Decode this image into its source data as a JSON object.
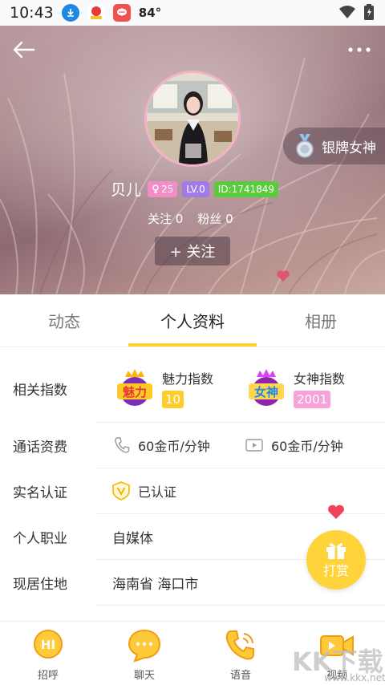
{
  "status_bar": {
    "time": "10:43",
    "temperature": "84°"
  },
  "profile": {
    "name": "贝儿",
    "age": "25",
    "level": "LV.0",
    "id": "ID:1741849",
    "follow_label": "关注",
    "follow_count": "0",
    "fans_label": "粉丝",
    "fans_count": "0",
    "follow_button": "+ 关注",
    "badge_text": "银牌女神"
  },
  "tabs": [
    {
      "label": "动态",
      "active": false
    },
    {
      "label": "个人资料",
      "active": true
    },
    {
      "label": "相册",
      "active": false
    }
  ],
  "info": {
    "index_label": "相关指数",
    "charm": {
      "logo_text": "魅力",
      "name": "魅力指数",
      "value": "10"
    },
    "goddess": {
      "logo_text": "女神",
      "name": "女神指数",
      "value": "2001"
    },
    "fee_label": "通话资费",
    "voice_fee": "60金币/分钟",
    "video_fee": "60金币/分钟",
    "realname_label": "实名认证",
    "realname_value": "已认证",
    "job_label": "个人职业",
    "job_value": "自媒体",
    "residence_label": "现居住地",
    "residence_value": "海南省 海口市"
  },
  "reward": {
    "label": "打赏"
  },
  "bottom_bar": {
    "greet_icon_text": "HI",
    "greet": "招呼",
    "chat": "聊天",
    "voice": "语音",
    "video": "视频"
  },
  "watermark": {
    "big": "KK下载",
    "small": "www.kkx.net"
  },
  "colors": {
    "accent": "#ffd32e",
    "tag_age": "#f28ec7",
    "tag_level": "#a37be8",
    "tag_id": "#5acb3d",
    "charm_value_bg": "#ffcc2e",
    "goddess_value_bg": "#f7a3d9"
  }
}
